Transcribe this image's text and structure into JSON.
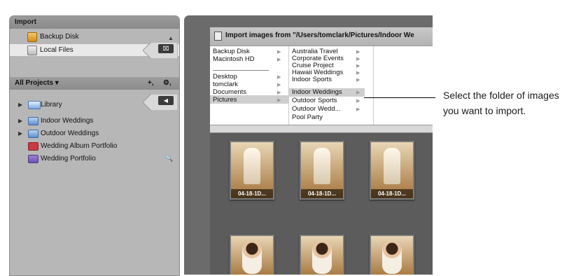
{
  "import_panel": {
    "header": "Import",
    "sources": [
      {
        "label": "Backup Disk",
        "icon": "disk-icon"
      },
      {
        "label": "Local Files",
        "icon": "files-icon",
        "selected": true
      }
    ]
  },
  "projects_panel": {
    "title": "All Projects ▾",
    "add_label": "+,",
    "gear_label": "⚙,",
    "items": [
      {
        "label": "Library",
        "icon": "library-icon",
        "expand": "▶"
      },
      {
        "label": "Indoor Weddings",
        "icon": "folder-icon",
        "expand": "▶"
      },
      {
        "label": "Outdoor Weddings",
        "icon": "folder-icon",
        "expand": "▶"
      },
      {
        "label": "Wedding Album Portfolio",
        "icon": "album-icon"
      },
      {
        "label": "Wedding Portfolio",
        "icon": "portfolio-icon"
      }
    ]
  },
  "browser": {
    "path_label": "Import images from \"/Users/tomclark/Pictures/Indoor We",
    "column1": [
      "Backup Disk",
      "Macintosh HD",
      "Desktop",
      "tomclark",
      "Documents",
      "Pictures"
    ],
    "column1_selected": "Pictures",
    "column2": [
      "Australia Travel",
      "Corporate Events",
      "Cruise Project",
      "Hawaii Weddings",
      "Indoor Sports",
      "Indoor Weddings",
      "Outdoor Sports",
      "Outdoor Wedd...",
      "Pool Party"
    ],
    "column2_selected": "Indoor Weddings"
  },
  "thumbnails": [
    {
      "caption": "04-18-1D..."
    },
    {
      "caption": "04-18-1D..."
    },
    {
      "caption": "04-18-1D..."
    },
    {
      "caption": ""
    },
    {
      "caption": ""
    },
    {
      "caption": ""
    }
  ],
  "callout": {
    "text": "Select the folder of images you want to import."
  },
  "colors": {
    "panel": "#b7b7b7",
    "selection": "#cfcfcf",
    "grid_bg": "#5c5c5c"
  }
}
